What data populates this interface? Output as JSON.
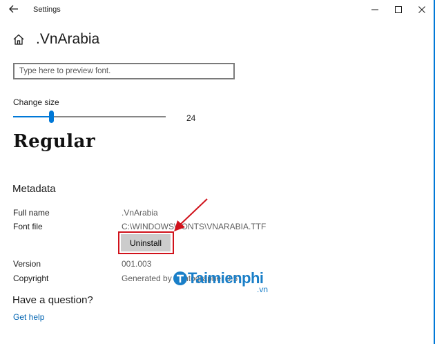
{
  "window": {
    "title": "Settings"
  },
  "page": {
    "title": ".VnArabia"
  },
  "preview": {
    "placeholder": "Type here to preview font."
  },
  "size": {
    "label": "Change size",
    "value": "24",
    "level_fraction": 0.25
  },
  "font_preview": {
    "text": "Regular"
  },
  "metadata": {
    "heading": "Metadata",
    "full_name_label": "Full name",
    "full_name_value": ".VnArabia",
    "font_file_label": "Font file",
    "font_file_value": "C:\\WINDOWS\\FONTS\\VNARABIA.TTF",
    "uninstall_label": "Uninstall",
    "version_label": "Version",
    "version_value": "001.003",
    "copyright_label": "Copyright",
    "copyright_value": "Generated by Fontographer 3.5"
  },
  "help": {
    "heading": "Have a question?",
    "link": "Get help"
  },
  "watermark": {
    "text": "Taimienphi",
    "sub": ".vn"
  },
  "colors": {
    "accent": "#0078d7",
    "annotation": "#d0121b",
    "watermark": "#1a7fc8"
  },
  "icons": [
    "back-arrow-icon",
    "minimize-icon",
    "maximize-icon",
    "close-icon",
    "home-icon"
  ]
}
